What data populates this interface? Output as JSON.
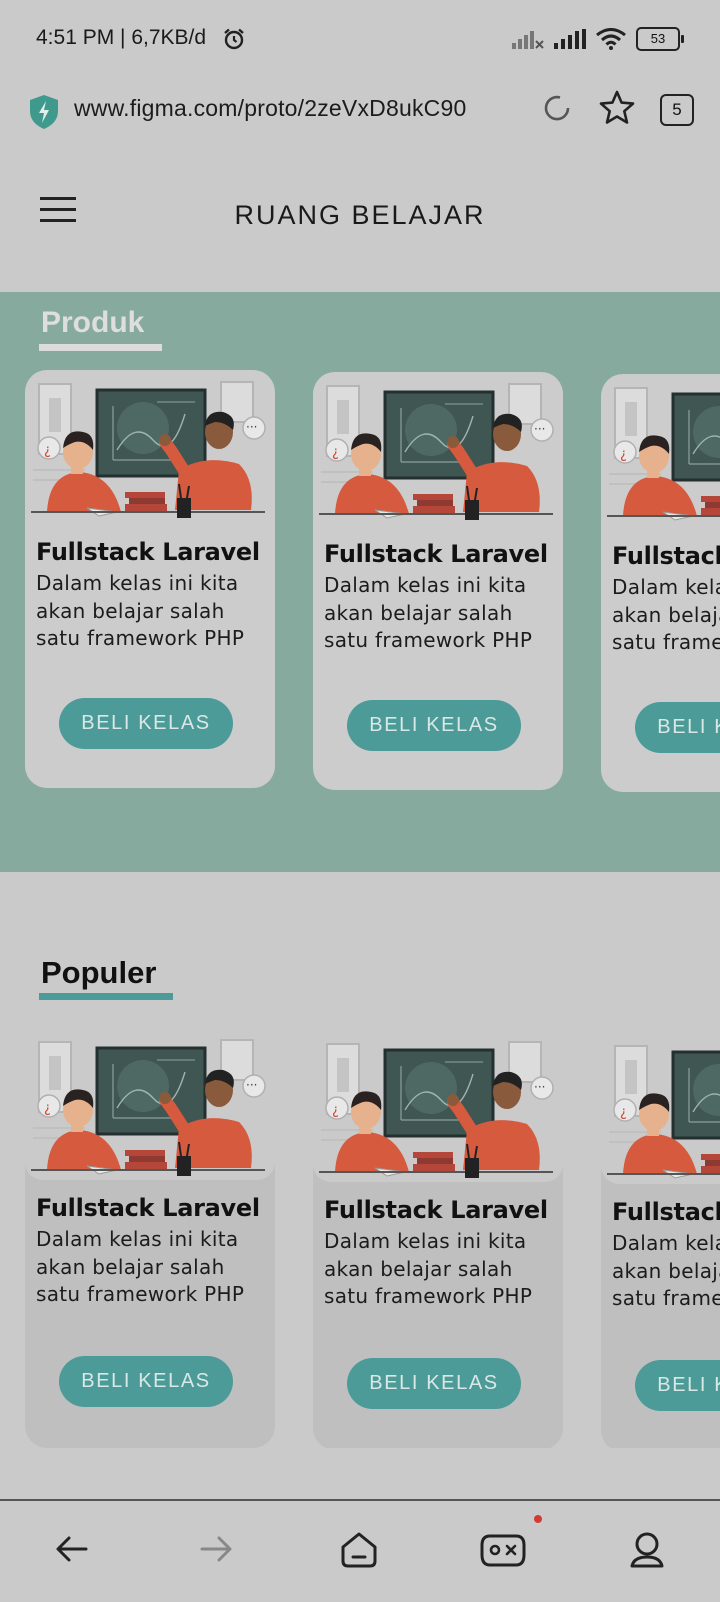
{
  "status_bar": {
    "time": "4:51 PM | 6,7KB/d",
    "battery": "53"
  },
  "browser": {
    "url": "www.figma.com/proto/2zeVxD8ukC90",
    "tabs_count": "5"
  },
  "header": {
    "title": "RUANG BELAJAR"
  },
  "produk": {
    "title": "Produk",
    "cards": [
      {
        "title": "Fullstack Laravel",
        "description": "Dalam kelas ini kita akan belajar salah satu framework PHP",
        "button": "BELI KELAS"
      },
      {
        "title": "Fullstack Laravel",
        "description": "Dalam kelas ini kita akan belajar salah satu framework PHP",
        "button": "BELI KELAS"
      },
      {
        "title": "Fullstack Laravel",
        "description": "Dalam kelas ini kita akan belajar salah satu framework PHP",
        "button": "BELI KELAS"
      }
    ]
  },
  "populer": {
    "title": "Populer",
    "cards": [
      {
        "title": "Fullstack Laravel",
        "description": "Dalam kelas ini kita akan belajar salah satu framework PHP",
        "button": "BELI KELAS"
      },
      {
        "title": "Fullstack Laravel",
        "description": "Dalam kelas ini kita akan belajar salah satu framework PHP",
        "button": "BELI KELAS"
      },
      {
        "title": "Fullstack Laravel",
        "description": "Dalam kelas ini kita akan belajar salah satu framework PHP",
        "button": "BELI KELAS"
      }
    ]
  },
  "bottom_nav": {
    "items": [
      "back-icon",
      "forward-icon",
      "home-icon",
      "game-icon",
      "profile-icon"
    ]
  },
  "colors": {
    "accent": "#4c9b98",
    "produk_bg": "#86aa9e",
    "page_bg": "#cacaca"
  }
}
